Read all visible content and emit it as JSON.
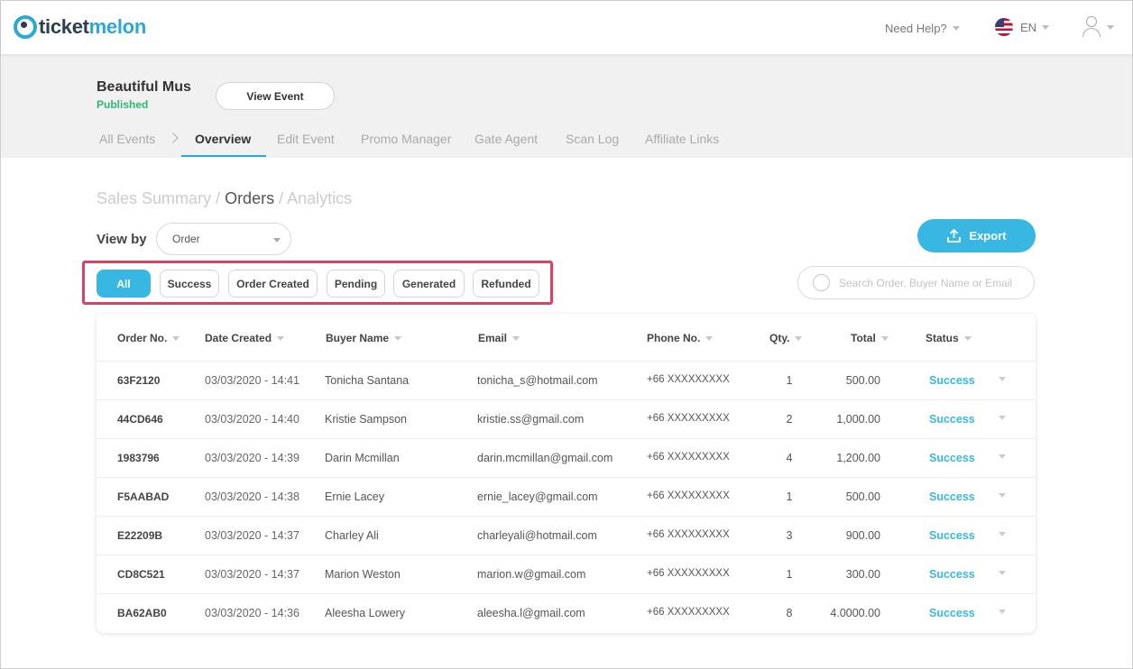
{
  "header": {
    "logo_part1": "ticket",
    "logo_part2": "melon",
    "help_label": "Need Help?",
    "language": "EN"
  },
  "event": {
    "name": "Beautiful Mus",
    "status": "Published",
    "status_color": "#2eb872",
    "view_button": "View Event"
  },
  "tabs": [
    {
      "label": "All Events",
      "active": false
    },
    {
      "label": "Overview",
      "active": true
    },
    {
      "label": "Edit Event",
      "active": false
    },
    {
      "label": "Promo Manager",
      "active": false
    },
    {
      "label": "Gate Agent",
      "active": false
    },
    {
      "label": "Scan Log",
      "active": false
    },
    {
      "label": "Affiliate Links",
      "active": false
    }
  ],
  "breadcrumb": {
    "sales_summary": "Sales Summary",
    "sep1": " / ",
    "orders": "Orders",
    "sep2": " / ",
    "analytics": "Analytics"
  },
  "view_by": {
    "label": "View by",
    "selected": "Order"
  },
  "export_label": "Export",
  "filters": [
    "All",
    "Success",
    "Order Created",
    "Pending",
    "Generated",
    "Refunded"
  ],
  "active_filter": "All",
  "search": {
    "placeholder": "Search Order, Buyer Name or Email"
  },
  "table": {
    "columns": [
      "Order No.",
      "Date Created",
      "Buyer Name",
      "Email",
      "Phone No.",
      "Qty.",
      "Total",
      "Status"
    ],
    "rows": [
      {
        "order": "63F2120",
        "date": "03/03/2020 - 14:41",
        "buyer": "Tonicha Santana",
        "email": "tonicha_s@hotmail.com",
        "phone": "+66  XXXXXXXXX",
        "qty": "1",
        "total": "500.00",
        "status": "Success"
      },
      {
        "order": "44CD646",
        "date": "03/03/2020 - 14:40",
        "buyer": "Kristie Sampson",
        "email": "kristie.ss@gmail.com",
        "phone": "+66  XXXXXXXXX",
        "qty": "2",
        "total": "1,000.00",
        "status": "Success"
      },
      {
        "order": "1983796",
        "date": "03/03/2020 - 14:39",
        "buyer": "Darin Mcmillan",
        "email": "darin.mcmillan@gmail.com",
        "phone": "+66  XXXXXXXXX",
        "qty": "4",
        "total": "1,200.00",
        "status": "Success"
      },
      {
        "order": "F5AABAD",
        "date": "03/03/2020 - 14:38",
        "buyer": "Ernie Lacey",
        "email": "ernie_lacey@gmail.com",
        "phone": "+66  XXXXXXXXX",
        "qty": "1",
        "total": "500.00",
        "status": "Success"
      },
      {
        "order": "E22209B",
        "date": "03/03/2020 - 14:37",
        "buyer": "Charley Ali",
        "email": "charleyali@hotmail.com",
        "phone": "+66  XXXXXXXXX",
        "qty": "3",
        "total": "900.00",
        "status": "Success"
      },
      {
        "order": "CD8C521",
        "date": "03/03/2020 - 14:37",
        "buyer": "Marion Weston",
        "email": "marion.w@gmail.com",
        "phone": "+66  XXXXXXXXX",
        "qty": "1",
        "total": "300.00",
        "status": "Success"
      },
      {
        "order": "BA62AB0",
        "date": "03/03/2020 - 14:36",
        "buyer": "Aleesha Lowery",
        "email": "aleesha.l@gmail.com",
        "phone": "+66  XXXXXXXXX",
        "qty": "8",
        "total": "4.0000.00",
        "status": "Success"
      }
    ]
  },
  "colors": {
    "accent": "#39b7e3",
    "highlight_box": "#e0405e",
    "success": "#39b7e3"
  }
}
